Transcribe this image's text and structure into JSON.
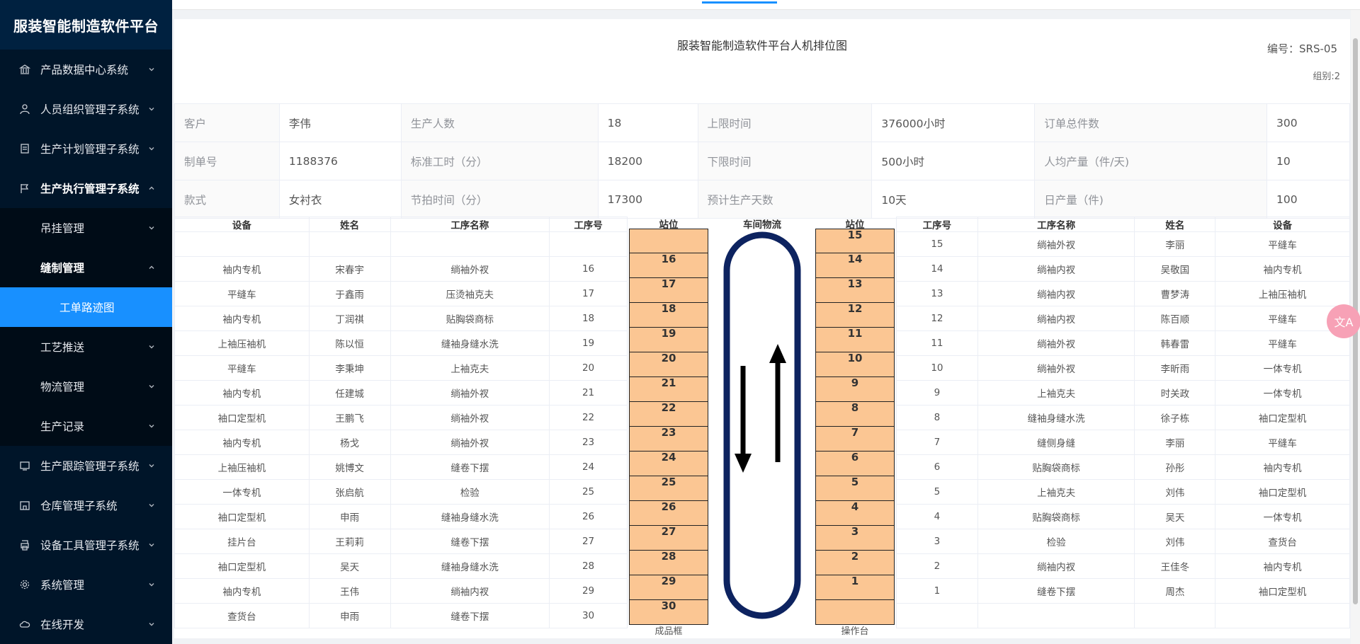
{
  "app": {
    "title": "服装智能制造软件平台"
  },
  "sidebar": {
    "items": [
      {
        "label": "产品数据中心系统",
        "icon": "bank-icon"
      },
      {
        "label": "人员组织管理子系统",
        "icon": "user-icon"
      },
      {
        "label": "生产计划管理子系统",
        "icon": "receipt-icon"
      },
      {
        "label": "生产执行管理子系统",
        "icon": "flag-icon"
      },
      {
        "label": "生产跟踪管理子系统",
        "icon": "monitor-icon"
      },
      {
        "label": "仓库管理子系统",
        "icon": "warehouse-icon"
      },
      {
        "label": "设备工具管理子系统",
        "icon": "printer-icon"
      },
      {
        "label": "系统管理",
        "icon": "gear-icon"
      },
      {
        "label": "在线开发",
        "icon": "cloud-icon"
      }
    ],
    "exec_sub": [
      {
        "label": "吊挂管理"
      },
      {
        "label": "缝制管理"
      },
      {
        "label": "工艺推送"
      },
      {
        "label": "物流管理"
      },
      {
        "label": "生产记录"
      }
    ],
    "sewing_sub": [
      {
        "label": "工单路迹图"
      }
    ]
  },
  "doc": {
    "title": "服装智能制造软件平台人机排位图",
    "number": "编号：SRS-05",
    "group": "组别:2"
  },
  "info": {
    "rows": [
      [
        "客户",
        "李伟",
        "生产人数",
        "18",
        "上限时间",
        "376000小时",
        "订单总件数",
        "300"
      ],
      [
        "制单号",
        "1188376",
        "标准工时（分）",
        "18200",
        "下限时间",
        "500小时",
        "人均产量（件/天)",
        "10"
      ],
      [
        "款式",
        "女衬衣",
        "节拍时间（分）",
        "17300",
        "预计生产天数",
        "10天",
        "日产量（件)",
        "100"
      ]
    ]
  },
  "layout": {
    "left_headers": [
      "设备",
      "姓名",
      "工序名称",
      "工序号"
    ],
    "right_headers": [
      "工序号",
      "工序名称",
      "姓名",
      "设备"
    ],
    "station_header": "站位",
    "logistics_header": "车间物流",
    "left_station_footer": "成品框",
    "right_station_footer": "操作台",
    "left_rows": [
      [
        "",
        "",
        "",
        ""
      ],
      [
        "袖内专机",
        "宋春宇",
        "绱袖外衩",
        "16"
      ],
      [
        "平缝车",
        "于鑫雨",
        "压烫袖克夫",
        "17"
      ],
      [
        "袖内专机",
        "丁润祺",
        "贴胸袋商标",
        "18"
      ],
      [
        "上袖压袖机",
        "陈以恒",
        "缝袖身缝水洗",
        "19"
      ],
      [
        "平缝车",
        "李秉坤",
        "上袖克夫",
        "20"
      ],
      [
        "袖内专机",
        "任建城",
        "绱袖外衩",
        "21"
      ],
      [
        "袖口定型机",
        "王鹏飞",
        "绱袖外衩",
        "22"
      ],
      [
        "袖内专机",
        "杨戈",
        "绱袖外衩",
        "23"
      ],
      [
        "上袖压袖机",
        "姚博文",
        "缝卷下摆",
        "24"
      ],
      [
        "一体专机",
        "张启航",
        "检验",
        "25"
      ],
      [
        "袖口定型机",
        "申雨",
        "缝袖身缝水洗",
        "26"
      ],
      [
        "挂片台",
        "王莉莉",
        "缝卷下摆",
        "27"
      ],
      [
        "袖口定型机",
        "吴天",
        "缝袖身缝水洗",
        "28"
      ],
      [
        "袖内专机",
        "王伟",
        "绱袖内衩",
        "29"
      ],
      [
        "查货台",
        "申雨",
        "缝卷下摆",
        "30"
      ]
    ],
    "left_stations": [
      "",
      "16",
      "17",
      "18",
      "19",
      "20",
      "21",
      "22",
      "23",
      "24",
      "25",
      "26",
      "27",
      "28",
      "29",
      "30"
    ],
    "right_stations": [
      "15",
      "14",
      "13",
      "12",
      "11",
      "10",
      "9",
      "8",
      "7",
      "6",
      "5",
      "4",
      "3",
      "2",
      "1",
      ""
    ],
    "right_rows": [
      [
        "15",
        "绱袖外衩",
        "李丽",
        "平缝车"
      ],
      [
        "14",
        "绱袖内衩",
        "吴敬国",
        "袖内专机"
      ],
      [
        "13",
        "绱袖内衩",
        "曹梦涛",
        "上袖压袖机"
      ],
      [
        "12",
        "绱袖内衩",
        "陈百顺",
        "平缝车"
      ],
      [
        "11",
        "绱袖外衩",
        "韩春雷",
        "平缝车"
      ],
      [
        "10",
        "绱袖外衩",
        "李昕雨",
        "一体专机"
      ],
      [
        "9",
        "上袖克夫",
        "时关政",
        "一体专机"
      ],
      [
        "8",
        "缝袖身缝水洗",
        "徐子栋",
        "袖口定型机"
      ],
      [
        "7",
        "缝侧身缝",
        "李丽",
        "平缝车"
      ],
      [
        "6",
        "贴胸袋商标",
        "孙彤",
        "袖内专机"
      ],
      [
        "5",
        "上袖克夫",
        "刘伟",
        "袖口定型机"
      ],
      [
        "4",
        "贴胸袋商标",
        "吴天",
        "一体专机"
      ],
      [
        "3",
        "检验",
        "刘伟",
        "查货台"
      ],
      [
        "2",
        "绱袖内衩",
        "王佳冬",
        "袖内专机"
      ],
      [
        "1",
        "缝卷下摆",
        "周杰",
        "袖口定型机"
      ],
      [
        "",
        "",
        "",
        ""
      ]
    ]
  },
  "translate_badge": "文A"
}
